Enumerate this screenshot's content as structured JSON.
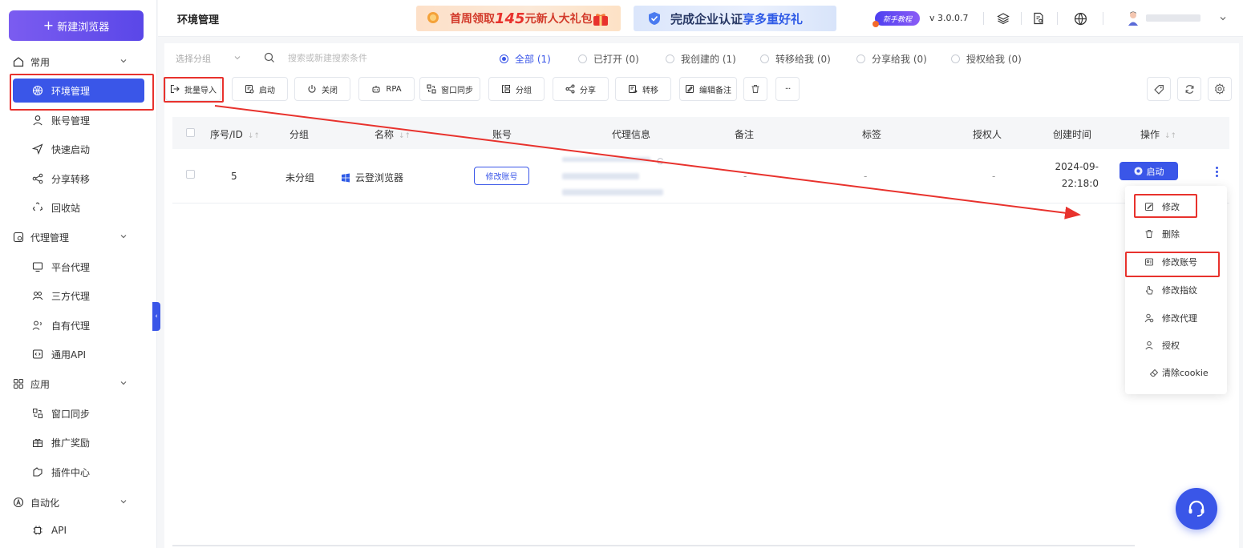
{
  "sidebar": {
    "new_browser_label": "新建浏览器",
    "groups": [
      {
        "label": "常用"
      },
      {
        "label": "代理管理"
      },
      {
        "label": "应用"
      },
      {
        "label": "自动化"
      }
    ],
    "items": {
      "env_manage": "环境管理",
      "account_manage": "账号管理",
      "quick_launch": "快速启动",
      "share_transfer": "分享转移",
      "recycle_bin": "回收站",
      "platform_proxy": "平台代理",
      "third_party_proxy": "三方代理",
      "own_proxy": "自有代理",
      "general_api": "通用API",
      "window_sync": "窗口同步",
      "promo_reward": "推广奖励",
      "plugin_center": "插件中心",
      "api": "API"
    }
  },
  "header": {
    "title": "环境管理",
    "banner1_prefix": "首周领取",
    "banner1_amount": "145",
    "banner1_suffix": "元新人大礼包",
    "banner2_prefix": "完成企业认证",
    "banner2_highlight": "享多重好礼",
    "tutorial_label": "新手教程",
    "version": "v 3.0.0.7"
  },
  "filters": {
    "group_select_placeholder": "选择分组",
    "search_placeholder": "搜索或新建搜索条件",
    "search_value": "",
    "radios": [
      {
        "label": "全部",
        "count": "(1)"
      },
      {
        "label": "已打开",
        "count": "(0)"
      },
      {
        "label": "我创建的",
        "count": "(1)"
      },
      {
        "label": "转移给我",
        "count": "(0)"
      },
      {
        "label": "分享给我",
        "count": "(0)"
      },
      {
        "label": "授权给我",
        "count": "(0)"
      }
    ]
  },
  "toolbar": {
    "batch_import": "批量导入",
    "launch": "启动",
    "close": "关闭",
    "rpa": "RPA",
    "window_sync": "窗口同步",
    "group": "分组",
    "share": "分享",
    "transfer": "转移",
    "edit_note": "编辑备注",
    "more": "···"
  },
  "table": {
    "columns": {
      "seq_id": "序号/ID",
      "group": "分组",
      "name": "名称",
      "account": "账号",
      "proxy": "代理信息",
      "note": "备注",
      "tag": "标签",
      "authorizer": "授权人",
      "created": "创建时间",
      "actions": "操作"
    },
    "rows": [
      {
        "seq": "5",
        "group": "未分组",
        "name": "云登浏览器",
        "account_btn": "修改账号",
        "note": "-",
        "tag": "-",
        "authorizer": "-",
        "created_date": "2024-09-",
        "created_time": "22:18:0",
        "launch_label": "启动"
      }
    ]
  },
  "dropdown": {
    "items": [
      "修改",
      "删除",
      "修改账号",
      "修改指纹",
      "修改代理",
      "授权",
      "清除cookie"
    ]
  },
  "colors": {
    "primary": "#3a56e8",
    "highlight_red": "#e8322d",
    "new_btn_gradient_start": "#7b5cf0"
  }
}
